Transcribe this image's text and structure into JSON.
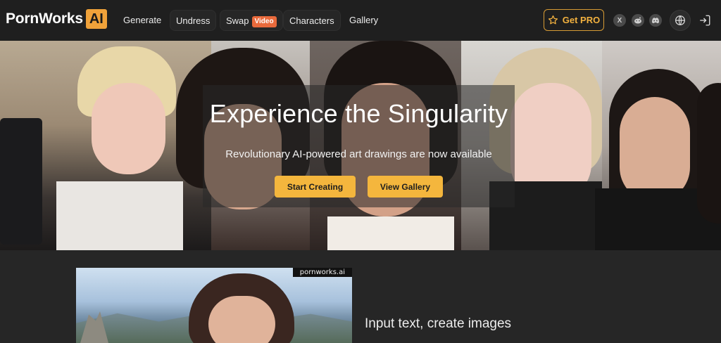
{
  "brand": {
    "name": "PornWorks",
    "badge": "AI",
    "accent": "#f0a23a"
  },
  "nav": {
    "items": [
      {
        "label": "Generate"
      },
      {
        "label": "Undress"
      },
      {
        "label": "Swap",
        "badge": "Video"
      },
      {
        "label": "Characters"
      },
      {
        "label": "Gallery"
      }
    ],
    "get_pro": "Get PRO",
    "social_icons": [
      "x-icon",
      "reddit-icon",
      "discord-icon"
    ],
    "x_glyph": "X"
  },
  "hero": {
    "title": "Experience the Singularity",
    "subtitle": "Revolutionary AI-powered art drawings are now available",
    "primary_button": "Start Creating",
    "secondary_button": "View Gallery",
    "button_color": "#f4b63d"
  },
  "feature": {
    "watermark": "pornworks.ai",
    "title": "Input text, create images"
  }
}
